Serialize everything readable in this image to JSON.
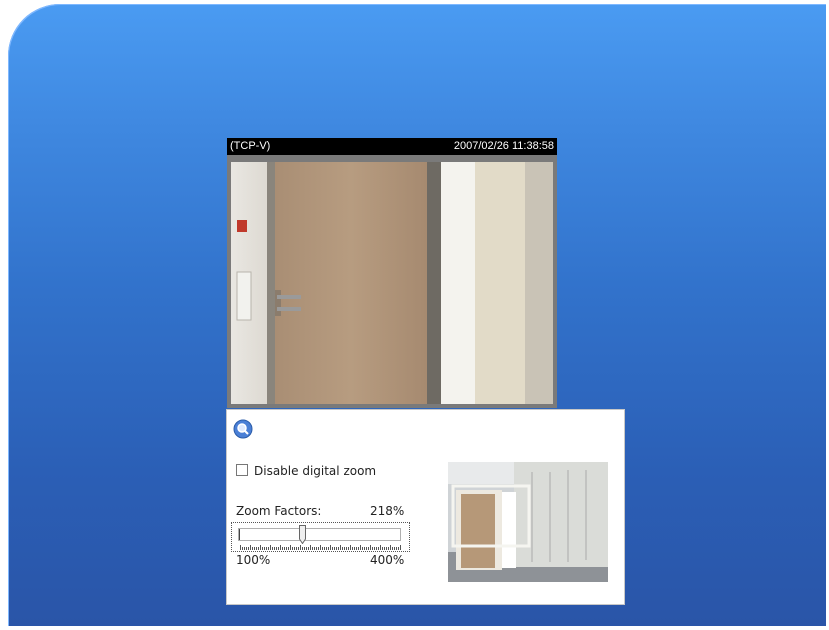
{
  "viewer": {
    "protocol": "(TCP-V)",
    "timestamp": "2007/02/26 11:38:58"
  },
  "zoom_panel": {
    "icon": "magnifier-icon",
    "disable_label": "Disable digital zoom",
    "disable_checked": false,
    "factor_label": "Zoom Factors:",
    "factor_value": "218%",
    "slider_min": "100%",
    "slider_max": "400%",
    "slider_level": 0.39
  },
  "colors": {
    "background_top": "#4a9bf2",
    "background_bottom": "#2a55a8",
    "panel": "#ffffff",
    "caption_bar": "#000000"
  }
}
